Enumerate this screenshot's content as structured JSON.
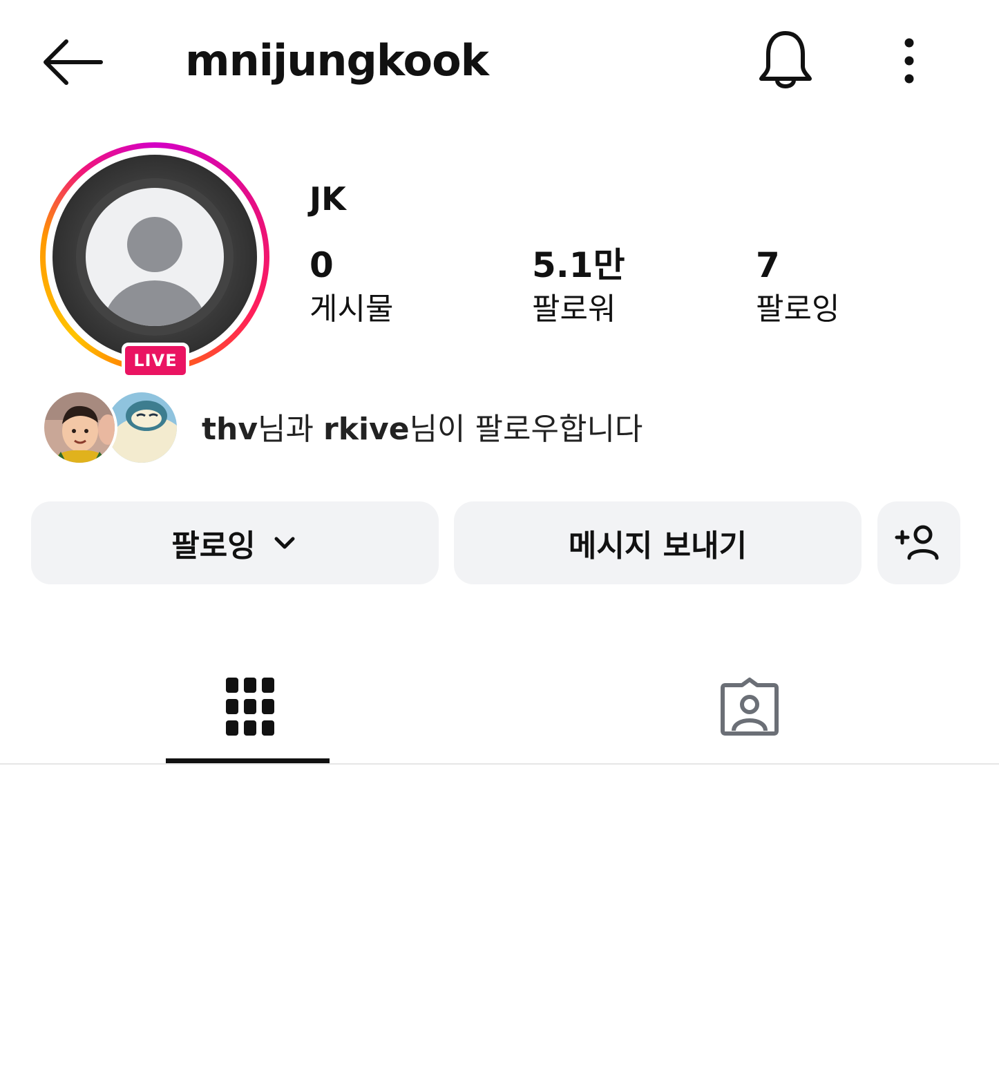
{
  "header": {
    "username": "mnijungkook",
    "back_icon": "arrow-left-icon",
    "bell_icon": "bell-icon",
    "more_icon": "more-vertical-icon"
  },
  "profile": {
    "display_name": "JK",
    "live_badge": "LIVE",
    "stats": [
      {
        "value": "0",
        "label": "게시물"
      },
      {
        "value": "5.1만",
        "label": "팔로워"
      },
      {
        "value": "7",
        "label": "팔로잉"
      }
    ]
  },
  "mutual": {
    "text_user1": "thv",
    "text_mid": "님과 ",
    "text_user2": "rkive",
    "text_end": "님이 팔로우합니다"
  },
  "actions": {
    "following_label": "팔로잉",
    "message_label": "메시지 보내기",
    "add_person_icon": "add-person-icon"
  },
  "tabs": {
    "grid_icon": "grid-icon",
    "tagged_icon": "tagged-person-icon",
    "active": "grid"
  },
  "colors": {
    "live": "#ea1462",
    "button_bg": "#f2f3f5",
    "text": "#111111"
  }
}
